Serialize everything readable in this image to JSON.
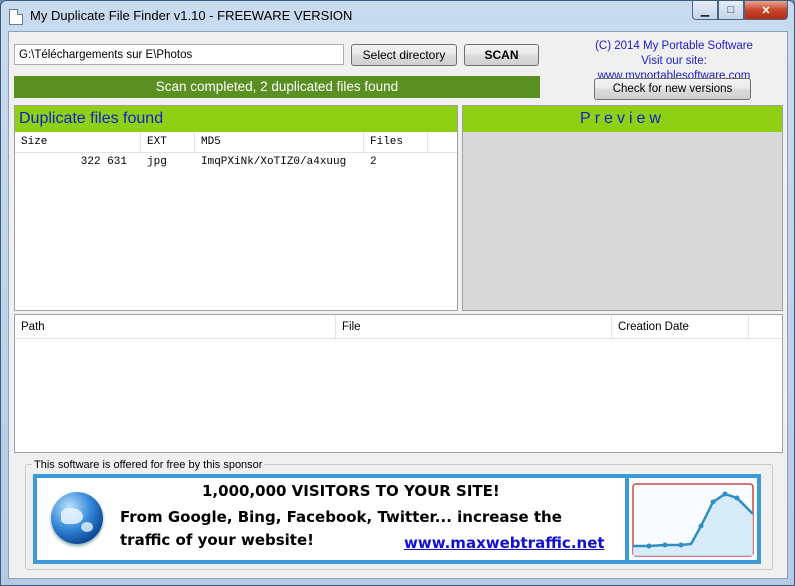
{
  "window": {
    "title": "My Duplicate File Finder v1.10 - FREEWARE VERSION",
    "controls": {
      "minimize": "▁",
      "maximize": "□",
      "close": "✕"
    }
  },
  "toolbar": {
    "directory_value": "G:\\Téléchargements sur E\\Photos",
    "select_directory_label": "Select directory",
    "scan_label": "SCAN",
    "check_versions_label": "Check for new versions"
  },
  "copyright": {
    "line1": "(C) 2014 My Portable Software",
    "line2": "Visit our site: www.myportablesoftware.com"
  },
  "status": {
    "text": "Scan completed, 2 duplicated files found"
  },
  "duplicates": {
    "title": "Duplicate files found",
    "columns": [
      "Size",
      "EXT",
      "MD5",
      "Files"
    ],
    "rows": [
      {
        "size": "322 631",
        "ext": "jpg",
        "md5": "ImqPXiNk/XoTIZ0/a4xuug",
        "files": "2"
      }
    ]
  },
  "preview": {
    "title": "Preview"
  },
  "files": {
    "columns": [
      "Path",
      "File",
      "Creation Date"
    ]
  },
  "sponsor": {
    "label": "This software is offered for free by this sponsor",
    "headline": "1,000,000 VISITORS TO YOUR SITE!",
    "line1": "From Google, Bing, Facebook, Twitter... increase the",
    "line2": "traffic of your website!",
    "url": "www.maxwebtraffic.net"
  },
  "colors": {
    "accent_green": "#8fd014",
    "status_green": "#5a8f22",
    "link_blue": "#1c1cc8",
    "banner_border": "#3e9ad6"
  }
}
